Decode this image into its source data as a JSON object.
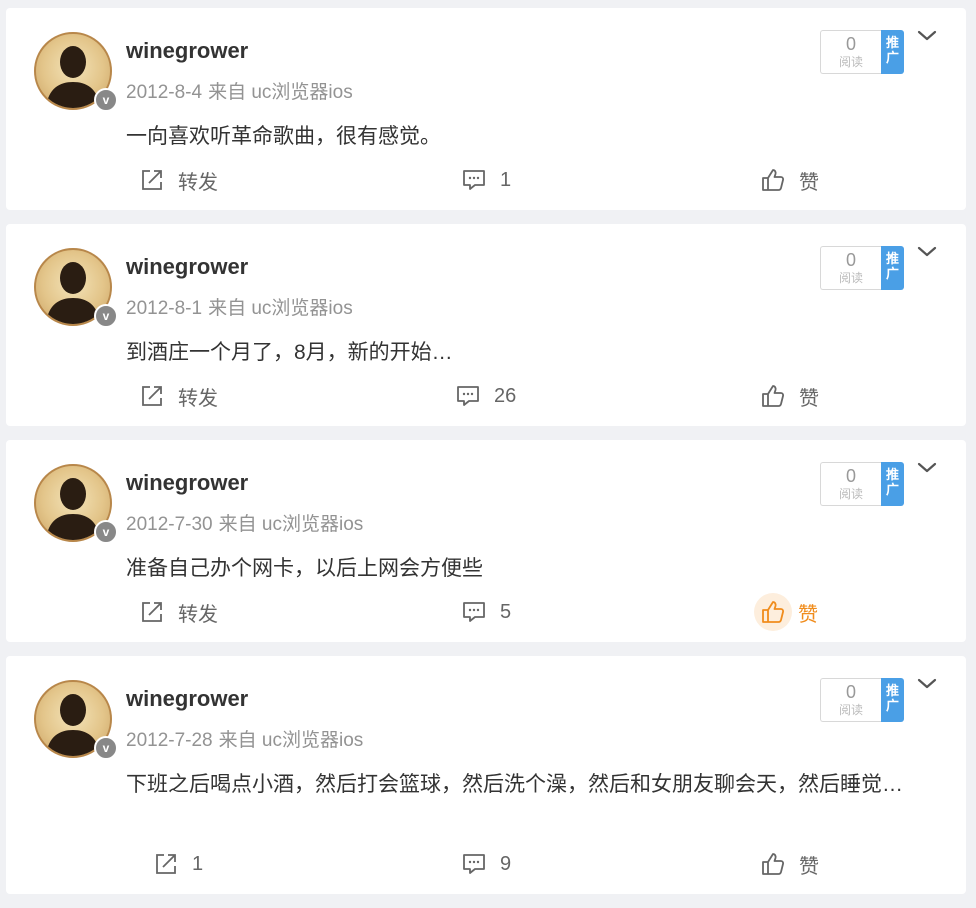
{
  "colors": {
    "background": "#f0f1f4",
    "card": "#ffffff",
    "username": "#333333",
    "meta": "#939393",
    "promo_tag": "#4a9fe6",
    "liked": "#f08c1c"
  },
  "icons": {
    "forward": "share-box-icon",
    "comment": "comment-bubble-icon",
    "like": "thumbs-up-icon",
    "more": "chevron-down-icon",
    "verified": "v-badge-icon"
  },
  "posts": [
    {
      "username": "winegrower",
      "date": "2012-8-4",
      "source": "来自 uc浏览器ios",
      "verified_mark": "v",
      "text": "一向喜欢听革命歌曲，很有感觉。",
      "promo": {
        "reads": "0",
        "reads_label": "阅读",
        "tag": "推广"
      },
      "forward_label": "转发",
      "comment_count": "1",
      "like_label": "赞",
      "liked": false
    },
    {
      "username": "winegrower",
      "date": "2012-8-1",
      "source": "来自 uc浏览器ios",
      "verified_mark": "v",
      "text": "到酒庄一个月了，8月，新的开始…",
      "promo": {
        "reads": "0",
        "reads_label": "阅读",
        "tag": "推广"
      },
      "forward_label": "转发",
      "comment_count": "26",
      "like_label": "赞",
      "liked": false
    },
    {
      "username": "winegrower",
      "date": "2012-7-30",
      "source": "来自 uc浏览器ios",
      "verified_mark": "v",
      "text": "准备自己办个网卡，以后上网会方便些",
      "promo": {
        "reads": "0",
        "reads_label": "阅读",
        "tag": "推广"
      },
      "forward_label": "转发",
      "comment_count": "5",
      "like_label": "赞",
      "liked": true
    },
    {
      "username": "winegrower",
      "date": "2012-7-28",
      "source": "来自 uc浏览器ios",
      "verified_mark": "v",
      "text": "下班之后喝点小酒，然后打会篮球，然后洗个澡，然后和女朋友聊会天，然后睡觉…",
      "promo": {
        "reads": "0",
        "reads_label": "阅读",
        "tag": "推广"
      },
      "forward_label": "1",
      "comment_count": "9",
      "like_label": "赞",
      "liked": false
    }
  ]
}
